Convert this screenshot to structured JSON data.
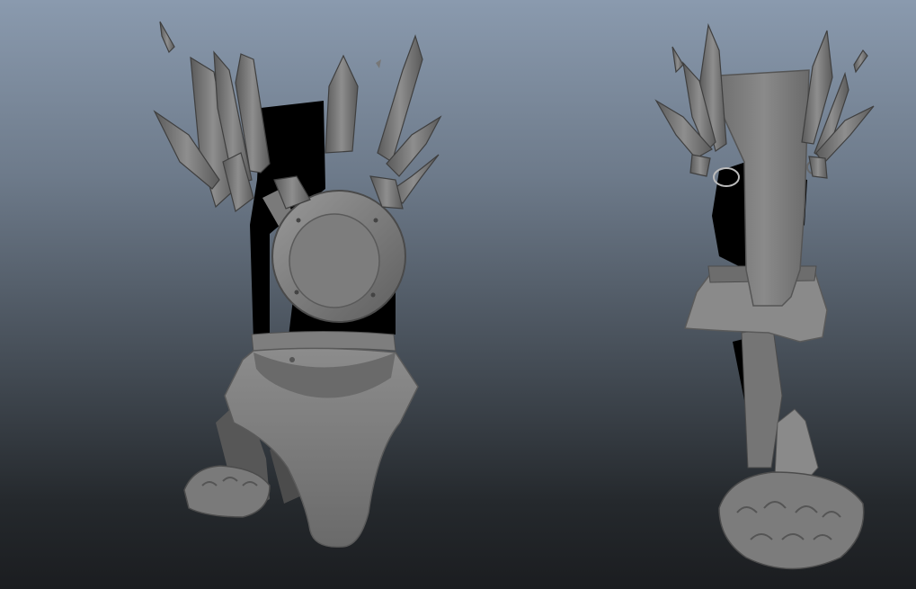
{
  "viewport": {
    "background_top": "#8a9aae",
    "background_bottom": "#1b1d20",
    "objects": [
      {
        "name": "armor-model-front-view",
        "shading": "untextured-gray"
      },
      {
        "name": "armor-model-back-view",
        "shading": "untextured-gray"
      }
    ]
  },
  "colors": {
    "mesh_light": "#8a8a8a",
    "mesh_mid": "#6f6f6f",
    "mesh_dark": "#4a4a4a",
    "mesh_shadow": "#000000"
  }
}
